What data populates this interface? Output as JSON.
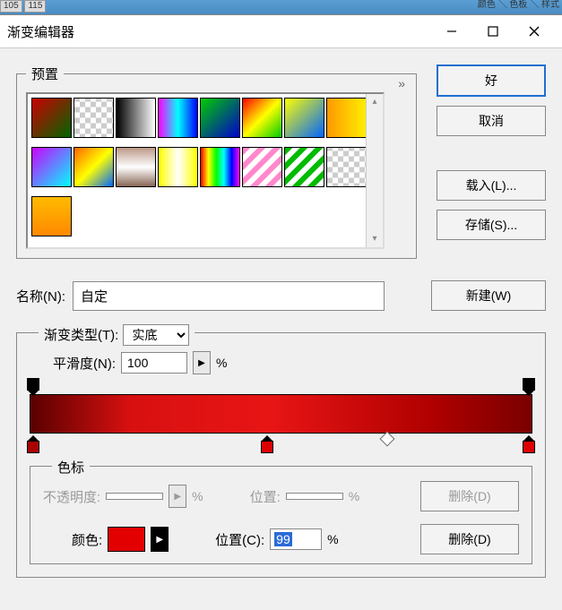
{
  "tabstrip": {
    "left1": "105",
    "left2": "115",
    "right": "颜色 ╲ 色板 ╲ 样式"
  },
  "titlebar": {
    "title": "渐变编辑器"
  },
  "presets": {
    "legend": "预置",
    "chevrons": "»"
  },
  "buttons": {
    "ok": "好",
    "cancel": "取消",
    "load": "载入(L)...",
    "save": "存储(S)...",
    "new": "新建(W)"
  },
  "name": {
    "label": "名称(N):",
    "value": "自定"
  },
  "gradient": {
    "type_label": "渐变类型(T):",
    "type_value": "实底",
    "smooth_label": "平滑度(N):",
    "smooth_value": "100",
    "smooth_unit": "%"
  },
  "stops": {
    "legend": "色标",
    "opacity_label": "不透明度:",
    "opacity_unit": "%",
    "pos_label": "位置:",
    "pos_unit": "%",
    "delete1": "删除(D)",
    "color_label": "颜色:",
    "pos2_label": "位置(C):",
    "pos2_value": "99",
    "pos2_unit": "%",
    "delete2": "删除(D)"
  },
  "swatches": [
    "linear-gradient(135deg,#c00,#060)",
    "repeating-conic-gradient(#ccc 0 25%,#fff 0 50%) 0/12px 12px",
    "linear-gradient(90deg,#000,#fff)",
    "linear-gradient(90deg,#f0f,#0ff,#00f)",
    "linear-gradient(135deg,#0c0,#00c)",
    "linear-gradient(135deg,#f00,#ff0,#0c0)",
    "linear-gradient(135deg,#ff0,#06f)",
    "linear-gradient(90deg,#f90,#fe0)",
    "linear-gradient(135deg,#c0f,#0ff)",
    "linear-gradient(135deg,#f60,#ff0,#06f)",
    "linear-gradient(180deg,#b98,#fff,#865)",
    "linear-gradient(90deg,#ff0,#fff,#ff0)",
    "linear-gradient(90deg,#f00,#ff0,#0f0,#0ff,#00f,#f0f)",
    "repeating-linear-gradient(135deg,#f8c 0 6px,#fff 6px 12px)",
    "repeating-linear-gradient(135deg,#0b0 0 6px,#fff 6px 12px)",
    "repeating-conic-gradient(#ccc 0 25%,#fff 0 50%) 0/12px 12px",
    "linear-gradient(180deg,#fb0,#f80)"
  ]
}
